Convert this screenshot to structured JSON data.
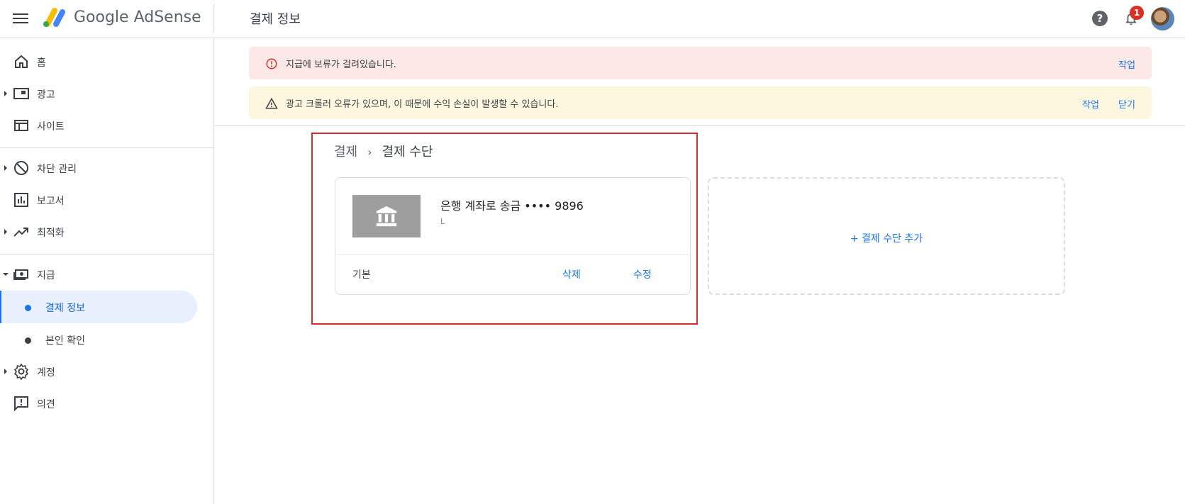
{
  "header": {
    "brand_google": "Google",
    "brand_product": "AdSense",
    "page_title": "결제 정보",
    "notification_count": "1",
    "help_glyph": "?"
  },
  "sidebar": {
    "items": [
      {
        "label": "홈",
        "icon": "home-icon"
      },
      {
        "label": "광고",
        "icon": "ads-icon"
      },
      {
        "label": "사이트",
        "icon": "sites-icon"
      },
      {
        "label": "차단 관리",
        "icon": "block-icon"
      },
      {
        "label": "보고서",
        "icon": "reports-icon"
      },
      {
        "label": "최적화",
        "icon": "trending-icon"
      },
      {
        "label": "지급",
        "icon": "payments-icon"
      },
      {
        "label": "계정",
        "icon": "gear-icon"
      },
      {
        "label": "의견",
        "icon": "feedback-icon"
      }
    ],
    "payments_sub": [
      {
        "label": "결제 정보",
        "active": true
      },
      {
        "label": "본인 확인",
        "active": false
      }
    ]
  },
  "alerts": {
    "error": {
      "text": "지급에 보류가 걸려있습니다.",
      "action": "작업"
    },
    "warning": {
      "text": "광고 크롤러 오류가 있으며, 이 때문에 수익 손실이 발생할 수 있습니다.",
      "action": "작업",
      "dismiss": "닫기"
    }
  },
  "breadcrumb": {
    "parent": "결제",
    "separator": "›",
    "current": "결제 수단"
  },
  "payment_method": {
    "title": "은행 계좌로 송금 •••• 9896",
    "subtitle": "L",
    "status": "기본",
    "delete": "삭제",
    "edit": "수정"
  },
  "add_payment": {
    "label": "+ 결제 수단 추가"
  },
  "colors": {
    "accent": "#1a73e8",
    "error_bg": "#fce8e6",
    "warning_bg": "#fef7e0",
    "highlight": "#d32f2f"
  }
}
